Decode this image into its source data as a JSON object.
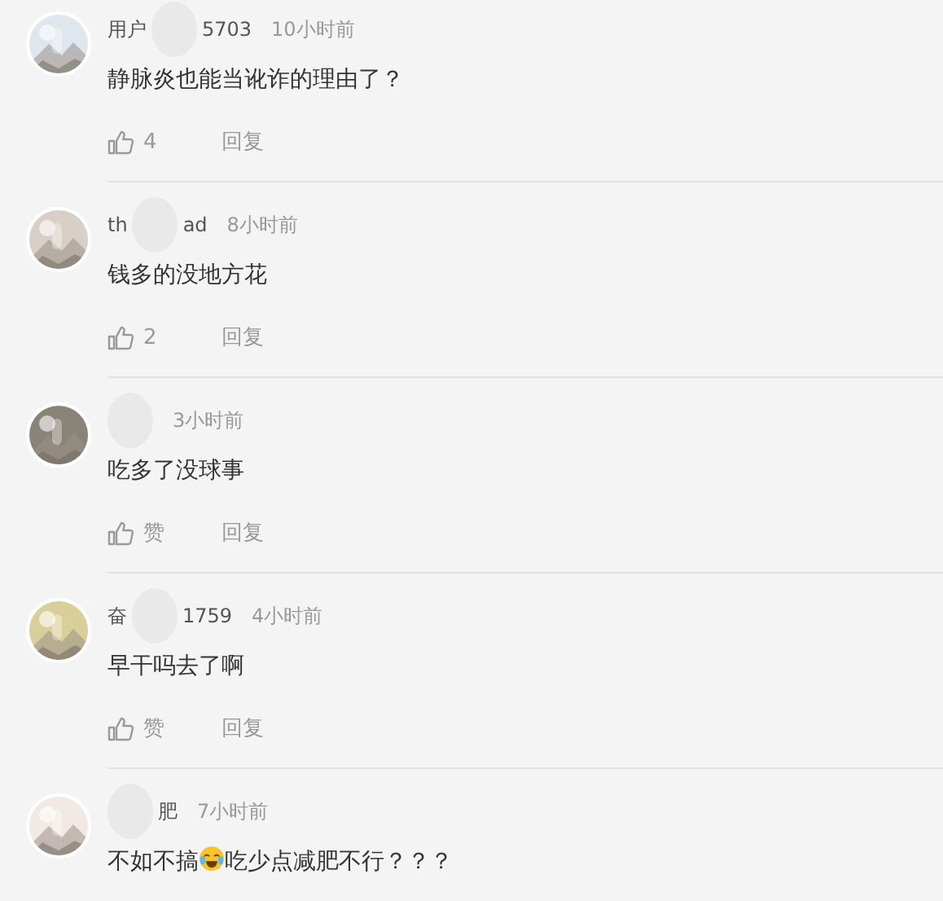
{
  "comments": [
    {
      "name_start": "用户",
      "name_end": "5703",
      "time": "10小时前",
      "content": [
        {
          "kind": "text",
          "text": "静脉炎也能当讹诈的理由了？"
        }
      ],
      "likes": "4",
      "reply": "回复"
    },
    {
      "name_start": "th",
      "name_end": "ad",
      "time": "8小时前",
      "content": [
        {
          "kind": "text",
          "text": "钱多的没地方花"
        }
      ],
      "likes": "2",
      "reply": "回复"
    },
    {
      "time": "3小时前",
      "content": [
        {
          "kind": "text",
          "text": "吃多了没球事"
        }
      ],
      "likes": "赞",
      "reply": "回复"
    },
    {
      "name_start": "奋",
      "name_end": "1759",
      "time": "4小时前",
      "content": [
        {
          "kind": "text",
          "text": "早干吗去了啊"
        }
      ],
      "likes": "赞",
      "reply": "回复"
    },
    {
      "name_end": "肥",
      "time": "7小时前",
      "content": [
        {
          "kind": "text",
          "text": "不如不搞"
        },
        {
          "kind": "emoji"
        },
        {
          "kind": "text",
          "text": "吃少点减肥不行？？？"
        }
      ]
    }
  ]
}
